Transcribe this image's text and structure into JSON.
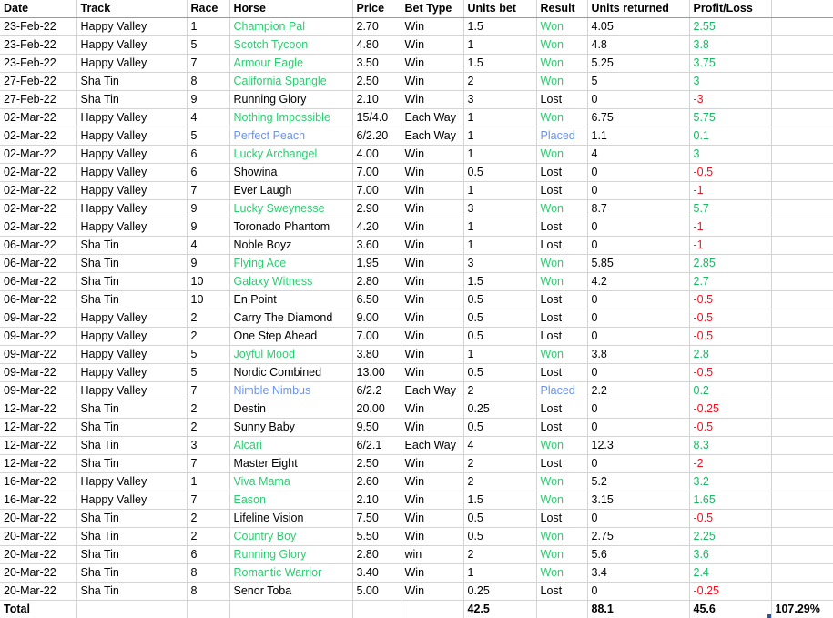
{
  "sheet": {
    "name": "betting-record",
    "columns": [
      {
        "key": "date",
        "label": "Date"
      },
      {
        "key": "track",
        "label": "Track"
      },
      {
        "key": "race",
        "label": "Race"
      },
      {
        "key": "horse",
        "label": "Horse"
      },
      {
        "key": "price",
        "label": "Price"
      },
      {
        "key": "bet_type",
        "label": "Bet Type"
      },
      {
        "key": "units_bet",
        "label": "Units bet"
      },
      {
        "key": "result",
        "label": "Result"
      },
      {
        "key": "returned",
        "label": "Units returned"
      },
      {
        "key": "profit",
        "label": "Profit/Loss"
      },
      {
        "key": "extra",
        "label": ""
      }
    ],
    "colors": {
      "won_green": "#2ecc71",
      "profit_green": "#18b862",
      "placed_blue": "#6d93e8",
      "loss_red": "#fc0d1b",
      "text_black": "#000000",
      "gridline": "#d4d4d4",
      "fill_handle": "#2b579a"
    },
    "rows": [
      {
        "date": "23-Feb-22",
        "track": "Happy Valley",
        "race": "1",
        "horse": "Champion Pal",
        "horse_color": "green",
        "price": "2.70",
        "bet_type": "Win",
        "units_bet": "1.5",
        "result": "Won",
        "result_color": "green",
        "returned": "4.05",
        "profit": "2.55",
        "profit_color": "green"
      },
      {
        "date": "23-Feb-22",
        "track": "Happy Valley",
        "race": "5",
        "horse": "Scotch Tycoon",
        "horse_color": "green",
        "price": "4.80",
        "bet_type": "Win",
        "units_bet": "1",
        "result": "Won",
        "result_color": "green",
        "returned": "4.8",
        "profit": "3.8",
        "profit_color": "green"
      },
      {
        "date": "23-Feb-22",
        "track": "Happy Valley",
        "race": "7",
        "horse": "Armour Eagle",
        "horse_color": "green",
        "price": "3.50",
        "bet_type": "Win",
        "units_bet": "1.5",
        "result": "Won",
        "result_color": "green",
        "returned": "5.25",
        "profit": "3.75",
        "profit_color": "green"
      },
      {
        "date": "27-Feb-22",
        "track": "Sha Tin",
        "race": "8",
        "horse": "California Spangle",
        "horse_color": "green",
        "price": "2.50",
        "bet_type": "Win",
        "units_bet": "2",
        "result": "Won",
        "result_color": "green",
        "returned": "5",
        "profit": "3",
        "profit_color": "green"
      },
      {
        "date": "27-Feb-22",
        "track": "Sha Tin",
        "race": "9",
        "horse": "Running Glory",
        "horse_color": "black",
        "price": "2.10",
        "bet_type": "Win",
        "units_bet": "3",
        "result": "Lost",
        "result_color": "black",
        "returned": "0",
        "profit": "-3",
        "profit_color": "red"
      },
      {
        "date": "02-Mar-22",
        "track": "Happy Valley",
        "race": "4",
        "horse": "Nothing Impossible",
        "horse_color": "green",
        "price": "15/4.0",
        "bet_type": "Each Way",
        "units_bet": "1",
        "result": "Won",
        "result_color": "green",
        "returned": "6.75",
        "profit": "5.75",
        "profit_color": "green"
      },
      {
        "date": "02-Mar-22",
        "track": "Happy Valley",
        "race": "5",
        "horse": "Perfect Peach",
        "horse_color": "blue",
        "price": "6/2.20",
        "bet_type": "Each Way",
        "units_bet": "1",
        "result": "Placed",
        "result_color": "blue",
        "returned": "1.1",
        "profit": "0.1",
        "profit_color": "green"
      },
      {
        "date": "02-Mar-22",
        "track": "Happy Valley",
        "race": "6",
        "horse": "Lucky Archangel",
        "horse_color": "green",
        "price": "4.00",
        "bet_type": "Win",
        "units_bet": "1",
        "result": "Won",
        "result_color": "green",
        "returned": "4",
        "profit": "3",
        "profit_color": "green"
      },
      {
        "date": "02-Mar-22",
        "track": "Happy Valley",
        "race": "6",
        "horse": "Showina",
        "horse_color": "black",
        "price": "7.00",
        "bet_type": "Win",
        "units_bet": "0.5",
        "result": "Lost",
        "result_color": "black",
        "returned": "0",
        "profit": "-0.5",
        "profit_color": "red"
      },
      {
        "date": "02-Mar-22",
        "track": "Happy Valley",
        "race": "7",
        "horse": "Ever Laugh",
        "horse_color": "black",
        "price": "7.00",
        "bet_type": "Win",
        "units_bet": "1",
        "result": "Lost",
        "result_color": "black",
        "returned": "0",
        "profit": "-1",
        "profit_color": "red"
      },
      {
        "date": "02-Mar-22",
        "track": "Happy Valley",
        "race": "9",
        "horse": "Lucky Sweynesse",
        "horse_color": "green",
        "price": "2.90",
        "bet_type": "Win",
        "units_bet": "3",
        "result": "Won",
        "result_color": "green",
        "returned": "8.7",
        "profit": "5.7",
        "profit_color": "green"
      },
      {
        "date": "02-Mar-22",
        "track": "Happy Valley",
        "race": "9",
        "horse": "Toronado Phantom",
        "horse_color": "black",
        "price": "4.20",
        "bet_type": "Win",
        "units_bet": "1",
        "result": "Lost",
        "result_color": "black",
        "returned": "0",
        "profit": "-1",
        "profit_color": "red"
      },
      {
        "date": "06-Mar-22",
        "track": "Sha Tin",
        "race": "4",
        "horse": "Noble Boyz",
        "horse_color": "black",
        "price": "3.60",
        "bet_type": "Win",
        "units_bet": "1",
        "result": "Lost",
        "result_color": "black",
        "returned": "0",
        "profit": "-1",
        "profit_color": "red"
      },
      {
        "date": "06-Mar-22",
        "track": "Sha Tin",
        "race": "9",
        "horse": "Flying Ace",
        "horse_color": "green",
        "price": "1.95",
        "bet_type": "Win",
        "units_bet": "3",
        "result": "Won",
        "result_color": "green",
        "returned": "5.85",
        "profit": "2.85",
        "profit_color": "green"
      },
      {
        "date": "06-Mar-22",
        "track": "Sha Tin",
        "race": "10",
        "horse": "Galaxy Witness",
        "horse_color": "green",
        "price": "2.80",
        "bet_type": "Win",
        "units_bet": "1.5",
        "result": "Won",
        "result_color": "green",
        "returned": "4.2",
        "profit": "2.7",
        "profit_color": "green"
      },
      {
        "date": "06-Mar-22",
        "track": "Sha Tin",
        "race": "10",
        "horse": "En Point",
        "horse_color": "black",
        "price": "6.50",
        "bet_type": "Win",
        "units_bet": "0.5",
        "result": "Lost",
        "result_color": "black",
        "returned": "0",
        "profit": "-0.5",
        "profit_color": "red"
      },
      {
        "date": "09-Mar-22",
        "track": "Happy Valley",
        "race": "2",
        "horse": "Carry The Diamond",
        "horse_color": "black",
        "price": "9.00",
        "bet_type": "Win",
        "units_bet": "0.5",
        "result": "Lost",
        "result_color": "black",
        "returned": "0",
        "profit": "-0.5",
        "profit_color": "red"
      },
      {
        "date": "09-Mar-22",
        "track": "Happy Valley",
        "race": "2",
        "horse": "One Step Ahead",
        "horse_color": "black",
        "price": "7.00",
        "bet_type": "Win",
        "units_bet": "0.5",
        "result": "Lost",
        "result_color": "black",
        "returned": "0",
        "profit": "-0.5",
        "profit_color": "red"
      },
      {
        "date": "09-Mar-22",
        "track": "Happy Valley",
        "race": "5",
        "horse": "Joyful Mood",
        "horse_color": "green",
        "price": "3.80",
        "bet_type": "Win",
        "units_bet": "1",
        "result": "Won",
        "result_color": "green",
        "returned": "3.8",
        "profit": "2.8",
        "profit_color": "green"
      },
      {
        "date": "09-Mar-22",
        "track": "Happy Valley",
        "race": "5",
        "horse": "Nordic Combined",
        "horse_color": "black",
        "price": "13.00",
        "bet_type": "Win",
        "units_bet": "0.5",
        "result": "Lost",
        "result_color": "black",
        "returned": "0",
        "profit": "-0.5",
        "profit_color": "red"
      },
      {
        "date": "09-Mar-22",
        "track": "Happy Valley",
        "race": "7",
        "horse": "Nimble Nimbus",
        "horse_color": "blue",
        "price": "6/2.2",
        "bet_type": "Each Way",
        "units_bet": "2",
        "result": "Placed",
        "result_color": "blue",
        "returned": "2.2",
        "profit": "0.2",
        "profit_color": "green"
      },
      {
        "date": "12-Mar-22",
        "track": "Sha Tin",
        "race": "2",
        "horse": "Destin",
        "horse_color": "black",
        "price": "20.00",
        "bet_type": "Win",
        "units_bet": "0.25",
        "result": "Lost",
        "result_color": "black",
        "returned": "0",
        "profit": "-0.25",
        "profit_color": "red"
      },
      {
        "date": "12-Mar-22",
        "track": "Sha Tin",
        "race": "2",
        "horse": "Sunny Baby",
        "horse_color": "black",
        "price": "9.50",
        "bet_type": "Win",
        "units_bet": "0.5",
        "result": "Lost",
        "result_color": "black",
        "returned": "0",
        "profit": "-0.5",
        "profit_color": "red"
      },
      {
        "date": "12-Mar-22",
        "track": "Sha Tin",
        "race": "3",
        "horse": "Alcari",
        "horse_color": "green",
        "price": "6/2.1",
        "bet_type": "Each Way",
        "units_bet": "4",
        "result": "Won",
        "result_color": "green",
        "returned": "12.3",
        "profit": "8.3",
        "profit_color": "green"
      },
      {
        "date": "12-Mar-22",
        "track": "Sha Tin",
        "race": "7",
        "horse": "Master Eight",
        "horse_color": "black",
        "price": "2.50",
        "bet_type": "Win",
        "units_bet": "2",
        "result": "Lost",
        "result_color": "black",
        "returned": "0",
        "profit": "-2",
        "profit_color": "red"
      },
      {
        "date": "16-Mar-22",
        "track": "Happy Valley",
        "race": "1",
        "horse": "Viva Mama",
        "horse_color": "green",
        "price": "2.60",
        "bet_type": "Win",
        "units_bet": "2",
        "result": "Won",
        "result_color": "green",
        "returned": "5.2",
        "profit": "3.2",
        "profit_color": "green"
      },
      {
        "date": "16-Mar-22",
        "track": "Happy Valley",
        "race": "7",
        "horse": "Eason",
        "horse_color": "green",
        "price": "2.10",
        "bet_type": "Win",
        "units_bet": "1.5",
        "result": "Won",
        "result_color": "green",
        "returned": "3.15",
        "profit": "1.65",
        "profit_color": "green"
      },
      {
        "date": "20-Mar-22",
        "track": "Sha Tin",
        "race": "2",
        "horse": "Lifeline Vision",
        "horse_color": "black",
        "price": "7.50",
        "bet_type": "Win",
        "units_bet": "0.5",
        "result": "Lost",
        "result_color": "black",
        "returned": "0",
        "profit": "-0.5",
        "profit_color": "red"
      },
      {
        "date": "20-Mar-22",
        "track": "Sha Tin",
        "race": "2",
        "horse": "Country Boy",
        "horse_color": "green",
        "price": "5.50",
        "bet_type": "Win",
        "units_bet": "0.5",
        "result": "Won",
        "result_color": "green",
        "returned": "2.75",
        "profit": "2.25",
        "profit_color": "green"
      },
      {
        "date": "20-Mar-22",
        "track": "Sha Tin",
        "race": "6",
        "horse": "Running Glory",
        "horse_color": "green",
        "price": "2.80",
        "bet_type": "win",
        "units_bet": "2",
        "result": "Won",
        "result_color": "green",
        "returned": "5.6",
        "profit": "3.6",
        "profit_color": "green"
      },
      {
        "date": "20-Mar-22",
        "track": "Sha Tin",
        "race": "8",
        "horse": "Romantic Warrior",
        "horse_color": "green",
        "price": "3.40",
        "bet_type": "Win",
        "units_bet": "1",
        "result": "Won",
        "result_color": "green",
        "returned": "3.4",
        "profit": "2.4",
        "profit_color": "green"
      },
      {
        "date": "20-Mar-22",
        "track": "Sha Tin",
        "race": "8",
        "horse": "Senor Toba",
        "horse_color": "black",
        "price": "5.00",
        "bet_type": "Win",
        "units_bet": "0.25",
        "result": "Lost",
        "result_color": "black",
        "returned": "0",
        "profit": "-0.25",
        "profit_color": "red"
      }
    ],
    "total_row": {
      "label": "Total",
      "track": "",
      "race": "",
      "horse": "",
      "price": "",
      "bet_type": "",
      "units_bet": "42.5",
      "result": "",
      "returned": "88.1",
      "profit": "45.6",
      "roi": "107.29%"
    }
  },
  "chart_data": {
    "type": "table",
    "title": "Horse racing betting record (23-Feb-22 to 20-Mar-22)",
    "columns": [
      "Date",
      "Track",
      "Race",
      "Horse",
      "Price",
      "Bet Type",
      "Units bet",
      "Result",
      "Units returned",
      "Profit/Loss",
      ""
    ],
    "totals": {
      "units_bet": 42.5,
      "units_returned": 88.1,
      "profit_loss": 45.6,
      "roi_percent": "107.29%"
    },
    "row_count": 32
  }
}
